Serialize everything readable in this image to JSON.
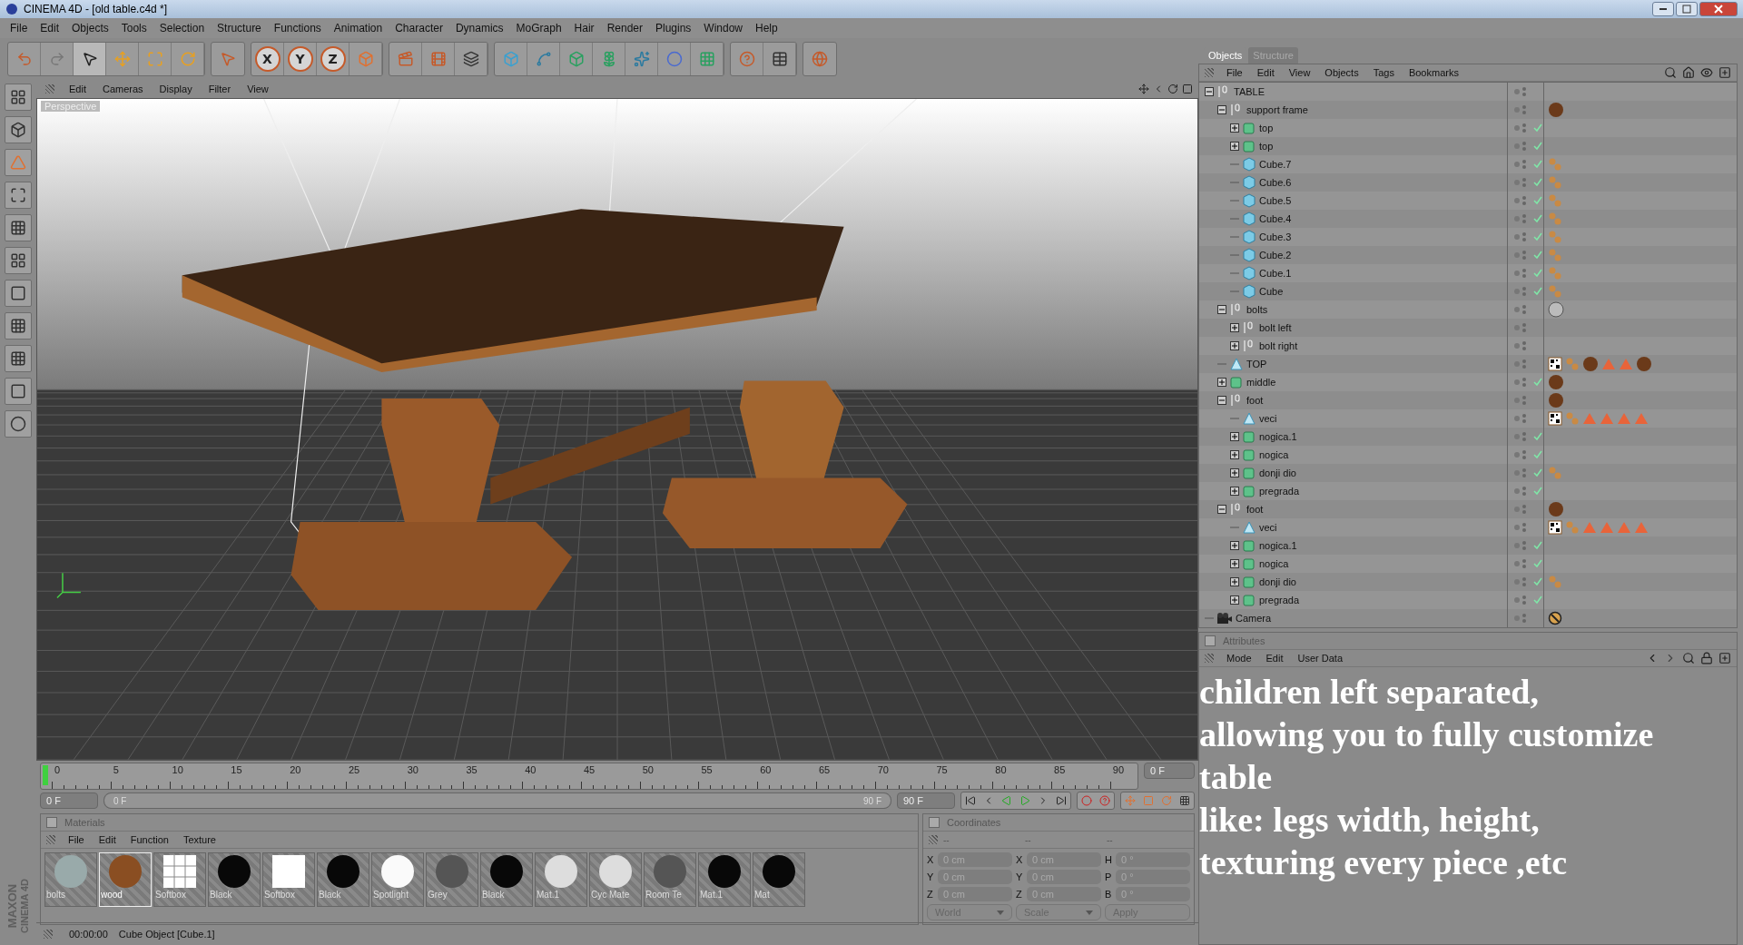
{
  "window": {
    "title": "CINEMA 4D - [old table.c4d *]"
  },
  "menu": [
    "File",
    "Edit",
    "Objects",
    "Tools",
    "Selection",
    "Structure",
    "Functions",
    "Animation",
    "Character",
    "Dynamics",
    "MoGraph",
    "Hair",
    "Render",
    "Plugins",
    "Window",
    "Help"
  ],
  "axis_buttons": [
    "X",
    "Y",
    "Z"
  ],
  "viewport": {
    "menu": [
      "Edit",
      "Cameras",
      "Display",
      "Filter",
      "View"
    ],
    "camera_label": "Perspective"
  },
  "timeline": {
    "ruler_labels": [
      "0",
      "5",
      "10",
      "15",
      "20",
      "25",
      "30",
      "35",
      "40",
      "45",
      "50",
      "55",
      "60",
      "65",
      "70",
      "75",
      "80",
      "85",
      "90"
    ],
    "current_frame": "0 F",
    "start_field": "0 F",
    "range_slider": {
      "start": "0 F",
      "end": "90 F",
      "level": 1
    },
    "end_field": "90 F"
  },
  "materials": {
    "title": "Materials",
    "checked": false,
    "menu": [
      "File",
      "Edit",
      "Function",
      "Texture"
    ],
    "items": [
      {
        "name": "bolts",
        "kind": "chrome",
        "selected": false
      },
      {
        "name": "wood",
        "kind": "wood",
        "selected": true
      },
      {
        "name": "Softbox",
        "kind": "grid",
        "selected": false
      },
      {
        "name": "Black",
        "kind": "black",
        "selected": false
      },
      {
        "name": "Softbox",
        "kind": "square",
        "selected": false
      },
      {
        "name": "Black",
        "kind": "black",
        "selected": false
      },
      {
        "name": "Spotlight",
        "kind": "white",
        "selected": false
      },
      {
        "name": "Grey",
        "kind": "grey",
        "selected": false
      },
      {
        "name": "Black",
        "kind": "black",
        "selected": false
      },
      {
        "name": "Mat.1",
        "kind": "light",
        "selected": false
      },
      {
        "name": "Cyc Mate",
        "kind": "light",
        "selected": false
      },
      {
        "name": "Room Te",
        "kind": "grey",
        "selected": false
      },
      {
        "name": "Mat.1",
        "kind": "black",
        "selected": false
      },
      {
        "name": "Mat",
        "kind": "black",
        "selected": false
      }
    ]
  },
  "coordinates": {
    "title": "Coordinates",
    "checked": false,
    "headers": [
      "--",
      "--",
      "--"
    ],
    "columns": [
      [
        {
          "axis": "X",
          "value": "0 cm"
        },
        {
          "axis": "Y",
          "value": "0 cm"
        },
        {
          "axis": "Z",
          "value": "0 cm"
        }
      ],
      [
        {
          "axis": "X",
          "value": "0 cm"
        },
        {
          "axis": "Y",
          "value": "0 cm"
        },
        {
          "axis": "Z",
          "value": "0 cm"
        }
      ],
      [
        {
          "axis": "H",
          "value": "0 °"
        },
        {
          "axis": "P",
          "value": "0 °"
        },
        {
          "axis": "B",
          "value": "0 °"
        }
      ]
    ],
    "dropdowns": [
      "World",
      "Scale"
    ],
    "apply": "Apply"
  },
  "status_bar": {
    "time": "00:00:00",
    "message": "Cube Object [Cube.1]"
  },
  "logo": [
    "MAXON",
    "CINEMA 4D"
  ],
  "objects_panel": {
    "tabs": [
      {
        "label": "Objects",
        "selected": true
      },
      {
        "label": "Structure",
        "selected": false
      }
    ],
    "menu": [
      "File",
      "Edit",
      "View",
      "Objects",
      "Tags",
      "Bookmarks"
    ],
    "tree": [
      {
        "name": "TABLE",
        "kind": "null",
        "expanded": true,
        "checked": false,
        "children": [
          {
            "name": "support frame",
            "kind": "null",
            "expanded": true,
            "checked": false,
            "tags": [
              {
                "kind": "material"
              }
            ],
            "children": [
              {
                "name": "top",
                "kind": "group",
                "expanded": false,
                "checked": true
              },
              {
                "name": "top",
                "kind": "group",
                "expanded": false,
                "checked": true
              },
              {
                "name": "Cube.7",
                "kind": "cube",
                "checked": true,
                "tags": [
                  {
                    "kind": "uvw"
                  }
                ]
              },
              {
                "name": "Cube.6",
                "kind": "cube",
                "checked": true,
                "tags": [
                  {
                    "kind": "uvw"
                  }
                ]
              },
              {
                "name": "Cube.5",
                "kind": "cube",
                "checked": true,
                "tags": [
                  {
                    "kind": "uvw"
                  }
                ]
              },
              {
                "name": "Cube.4",
                "kind": "cube",
                "checked": true,
                "tags": [
                  {
                    "kind": "uvw"
                  }
                ]
              },
              {
                "name": "Cube.3",
                "kind": "cube",
                "checked": true,
                "tags": [
                  {
                    "kind": "uvw"
                  }
                ]
              },
              {
                "name": "Cube.2",
                "kind": "cube",
                "checked": true,
                "tags": [
                  {
                    "kind": "uvw"
                  }
                ]
              },
              {
                "name": "Cube.1",
                "kind": "cube",
                "checked": true,
                "tags": [
                  {
                    "kind": "uvw"
                  }
                ]
              },
              {
                "name": "Cube",
                "kind": "cube",
                "checked": true,
                "tags": [
                  {
                    "kind": "uvw"
                  }
                ]
              }
            ]
          },
          {
            "name": "bolts",
            "kind": "null",
            "expanded": true,
            "checked": false,
            "tags": [
              {
                "kind": "chrome"
              }
            ],
            "children": [
              {
                "name": "bolt left",
                "kind": "null",
                "expanded": false,
                "checked": false
              },
              {
                "name": "bolt right",
                "kind": "null",
                "expanded": false,
                "checked": false
              }
            ]
          },
          {
            "name": "TOP",
            "kind": "polygon",
            "checked": false,
            "tags": [
              {
                "kind": "checker"
              },
              {
                "kind": "uvw"
              },
              {
                "kind": "material"
              },
              {
                "kind": "triangle"
              },
              {
                "kind": "triangle"
              },
              {
                "kind": "material"
              }
            ]
          },
          {
            "name": "middle",
            "kind": "group",
            "expanded": false,
            "checked": true,
            "tags": [
              {
                "kind": "material"
              }
            ]
          },
          {
            "name": "foot",
            "kind": "null",
            "expanded": true,
            "checked": false,
            "tags": [
              {
                "kind": "material"
              }
            ],
            "children": [
              {
                "name": "veci",
                "kind": "polygon",
                "checked": false,
                "tags": [
                  {
                    "kind": "checker"
                  },
                  {
                    "kind": "uvw"
                  },
                  {
                    "kind": "triangle"
                  },
                  {
                    "kind": "triangle"
                  },
                  {
                    "kind": "triangle"
                  },
                  {
                    "kind": "triangle"
                  }
                ]
              },
              {
                "name": "nogica.1",
                "kind": "group",
                "expanded": false,
                "checked": true
              },
              {
                "name": "nogica",
                "kind": "group",
                "expanded": false,
                "checked": true
              },
              {
                "name": "donji dio",
                "kind": "group",
                "expanded": false,
                "checked": true,
                "tags": [
                  {
                    "kind": "uvw"
                  }
                ]
              },
              {
                "name": "pregrada",
                "kind": "group",
                "expanded": false,
                "checked": true
              }
            ]
          },
          {
            "name": "foot",
            "kind": "null",
            "expanded": true,
            "checked": false,
            "tags": [
              {
                "kind": "material"
              }
            ],
            "children": [
              {
                "name": "veci",
                "kind": "polygon",
                "checked": false,
                "tags": [
                  {
                    "kind": "checker"
                  },
                  {
                    "kind": "uvw"
                  },
                  {
                    "kind": "triangle"
                  },
                  {
                    "kind": "triangle"
                  },
                  {
                    "kind": "triangle"
                  },
                  {
                    "kind": "triangle"
                  }
                ]
              },
              {
                "name": "nogica.1",
                "kind": "group",
                "expanded": false,
                "checked": true
              },
              {
                "name": "nogica",
                "kind": "group",
                "expanded": false,
                "checked": true
              },
              {
                "name": "donji dio",
                "kind": "group",
                "expanded": false,
                "checked": true,
                "tags": [
                  {
                    "kind": "uvw"
                  }
                ]
              },
              {
                "name": "pregrada",
                "kind": "group",
                "expanded": false,
                "checked": true
              }
            ]
          }
        ]
      },
      {
        "name": "Camera",
        "kind": "camera",
        "checked": false,
        "tags": [
          {
            "kind": "restrict"
          }
        ]
      }
    ]
  },
  "attributes_panel": {
    "title": "Attributes",
    "checked": false,
    "menu": [
      "Mode",
      "Edit",
      "User Data"
    ]
  },
  "caption": [
    "children left separated,",
    "allowing you to fully customize",
    "table",
    "like: legs width, height,",
    "texturing every piece ,etc"
  ]
}
